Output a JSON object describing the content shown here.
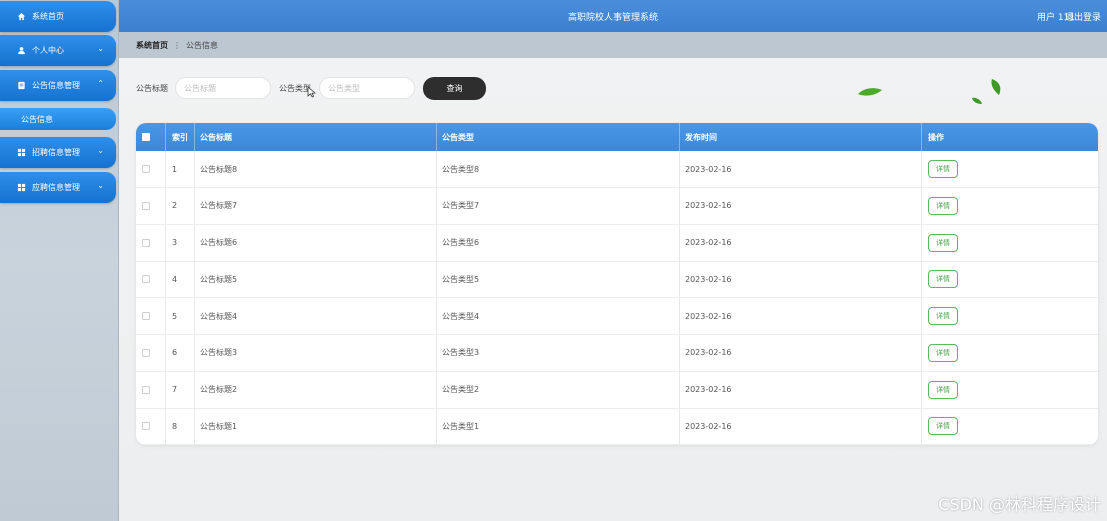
{
  "sidebar": {
    "items": [
      {
        "label": "系统首页",
        "icon": "home-icon"
      },
      {
        "label": "个人中心",
        "icon": "user-icon"
      },
      {
        "label": "公告信息管理",
        "icon": "document-icon"
      },
      {
        "label": "招聘信息管理",
        "icon": "grid-icon"
      },
      {
        "label": "应聘信息管理",
        "icon": "grid-icon"
      }
    ],
    "submenu": {
      "label": "公告信息"
    }
  },
  "header": {
    "title": "高职院校人事管理系统",
    "user": "用户 111",
    "logout": "退出登录"
  },
  "breadcrumb": {
    "home": "系统首页",
    "current": "公告信息"
  },
  "search": {
    "title_label": "公告标题",
    "title_placeholder": "公告标题",
    "type_label": "公告类型",
    "type_placeholder": "公告类型",
    "button": "查询"
  },
  "table": {
    "columns": [
      "索引",
      "公告标题",
      "公告类型",
      "发布时间",
      "操作"
    ],
    "rows": [
      {
        "index": "1",
        "title": "公告标题8",
        "type": "公告类型8",
        "date": "2023-02-16",
        "action": "详情"
      },
      {
        "index": "2",
        "title": "公告标题7",
        "type": "公告类型7",
        "date": "2023-02-16",
        "action": "详情"
      },
      {
        "index": "3",
        "title": "公告标题6",
        "type": "公告类型6",
        "date": "2023-02-16",
        "action": "详情"
      },
      {
        "index": "4",
        "title": "公告标题5",
        "type": "公告类型5",
        "date": "2023-02-16",
        "action": "详情"
      },
      {
        "index": "5",
        "title": "公告标题4",
        "type": "公告类型4",
        "date": "2023-02-16",
        "action": "详情"
      },
      {
        "index": "6",
        "title": "公告标题3",
        "type": "公告类型3",
        "date": "2023-02-16",
        "action": "详情"
      },
      {
        "index": "7",
        "title": "公告标题2",
        "type": "公告类型2",
        "date": "2023-02-16",
        "action": "详情"
      },
      {
        "index": "8",
        "title": "公告标题1",
        "type": "公告类型1",
        "date": "2023-02-16",
        "action": "详情"
      }
    ]
  },
  "watermark": "CSDN @林科程序设计",
  "colors": {
    "primary": "#3c87da",
    "sidebar_button": "#1672d0",
    "detail_border": "#5cb85c",
    "search_button": "#2e2e2e"
  }
}
